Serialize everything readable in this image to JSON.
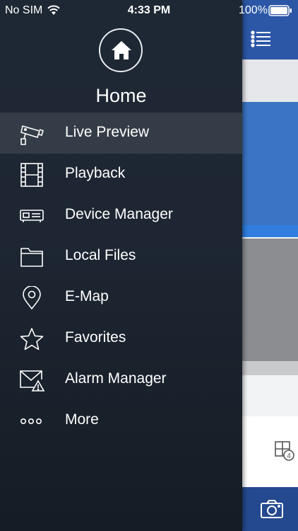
{
  "status_bar": {
    "carrier": "No SIM",
    "time": "4:33 PM",
    "battery": "100%"
  },
  "drawer": {
    "title": "Home",
    "items": [
      {
        "label": "Live Preview",
        "icon": "camera-cctv-icon",
        "active": true
      },
      {
        "label": "Playback",
        "icon": "film-icon"
      },
      {
        "label": "Device Manager",
        "icon": "dvr-icon"
      },
      {
        "label": "Local Files",
        "icon": "folder-icon"
      },
      {
        "label": "E-Map",
        "icon": "map-pin-icon"
      },
      {
        "label": "Favorites",
        "icon": "star-icon"
      },
      {
        "label": "Alarm Manager",
        "icon": "alarm-envelope-icon"
      },
      {
        "label": "More",
        "icon": "more-dots-icon"
      }
    ]
  },
  "background_app": {
    "grid_badge": "4"
  },
  "colors": {
    "accent": "#2c57a6",
    "drawer_bg": "#1d2632"
  }
}
